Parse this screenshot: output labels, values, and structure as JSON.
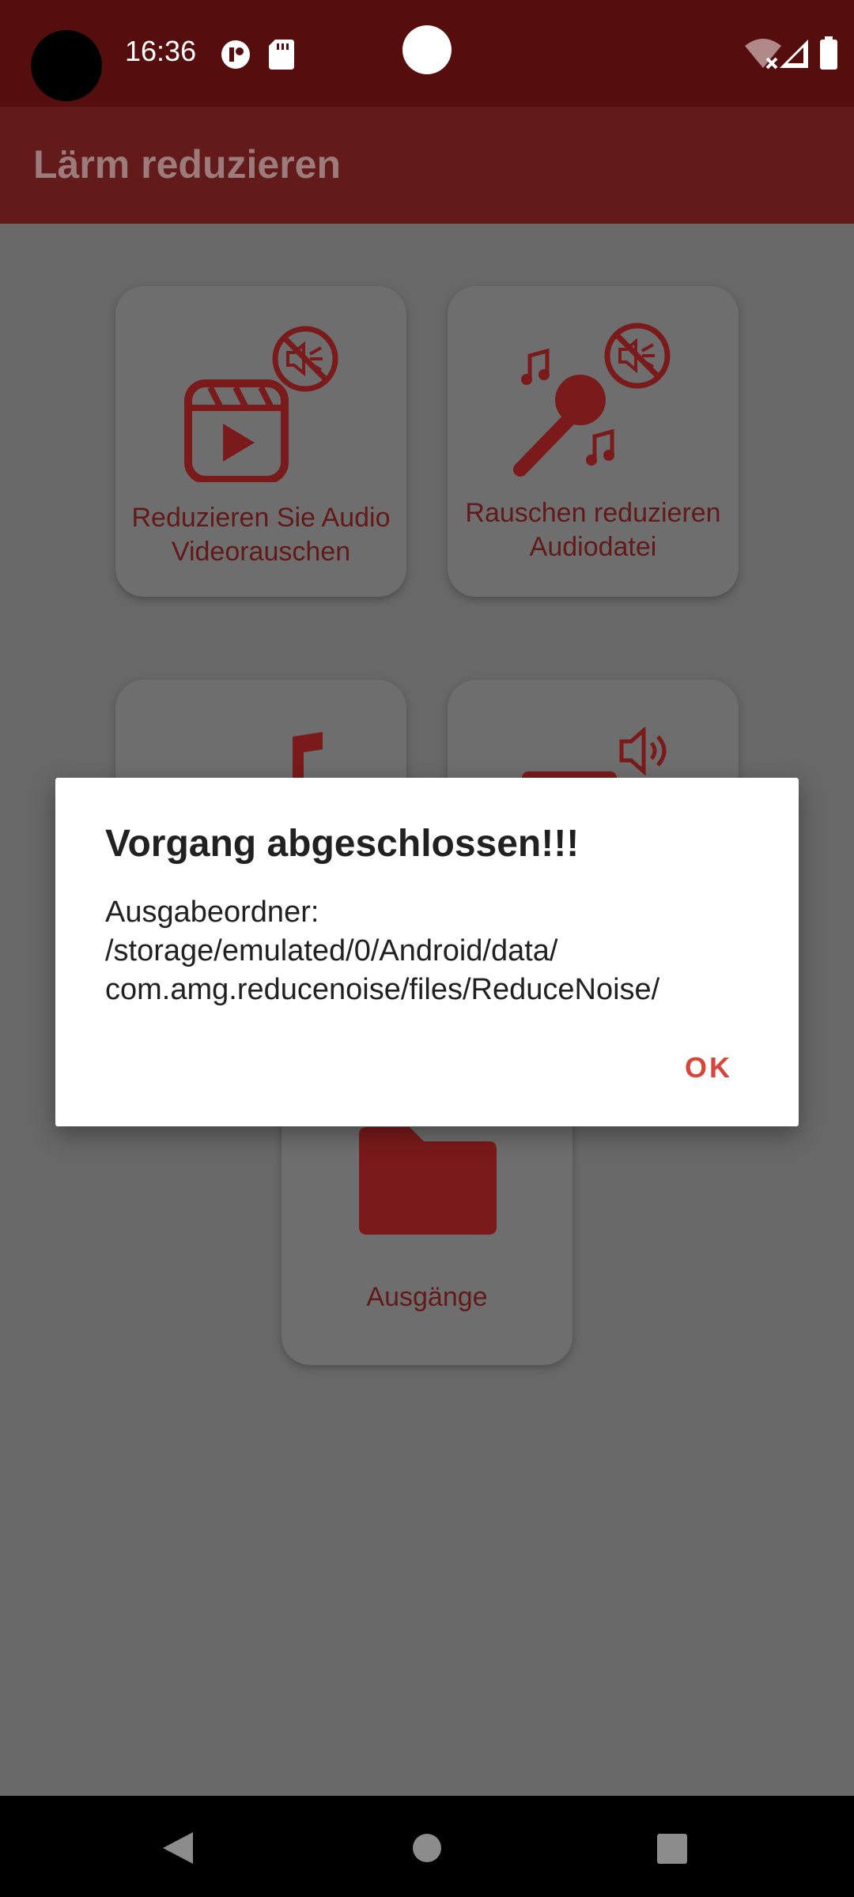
{
  "status_bar": {
    "time": "16:36",
    "icons": [
      "notification-icon",
      "sd-card-icon",
      "wifi-off-icon",
      "signal-icon",
      "battery-icon"
    ]
  },
  "app_bar": {
    "title": "Lärm reduzieren"
  },
  "cards": {
    "video": {
      "label_line1": "Reduzieren Sie Audio",
      "label_line2": "Videorauschen",
      "icon": "video-mute-icon"
    },
    "audio": {
      "label_line1": "Rauschen reduzieren",
      "label_line2": "Audiodatei",
      "icon": "microphone-mute-icon"
    },
    "music": {
      "icon": "music-note-icon"
    },
    "speaker": {
      "icon": "speaker-icon"
    },
    "outputs": {
      "label": "Ausgänge",
      "icon": "folder-icon"
    }
  },
  "dialog": {
    "title": "Vorgang abgeschlossen!!!",
    "message_line1": "Ausgabeordner:",
    "message_line2": "/storage/emulated/0/Android/data/",
    "message_line3": "com.amg.reducenoise/files/ReduceNoise/",
    "ok_label": "OK"
  },
  "nav_bar": {
    "buttons": [
      "back-icon",
      "home-icon",
      "recents-icon"
    ]
  },
  "colors": {
    "status_bar": "#550e0d",
    "app_bar": "#631a1a",
    "scrim_background": "#686868",
    "icon_red": "#7a1a1a",
    "ok_accent": "#d8443a"
  }
}
